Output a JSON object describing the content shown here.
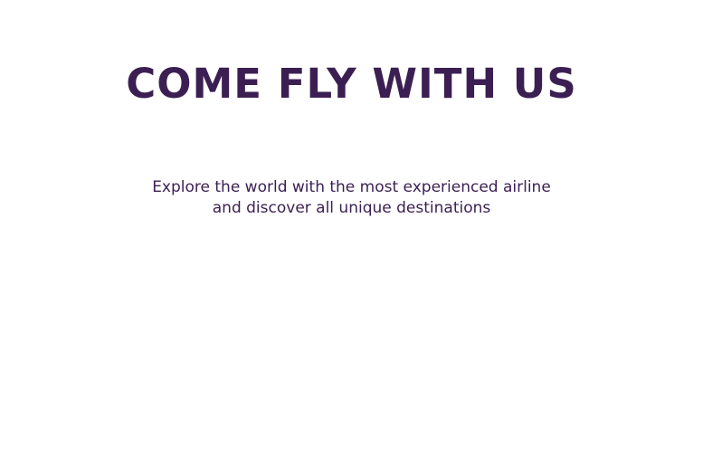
{
  "theme": {
    "text_color": "#3c1f52",
    "background_color": "#ffffff"
  },
  "hero": {
    "title": "COME FLY WITH US",
    "subtitle_line1": "Explore the world with the most experienced airline",
    "subtitle_line2": "and discover all unique destinations"
  }
}
